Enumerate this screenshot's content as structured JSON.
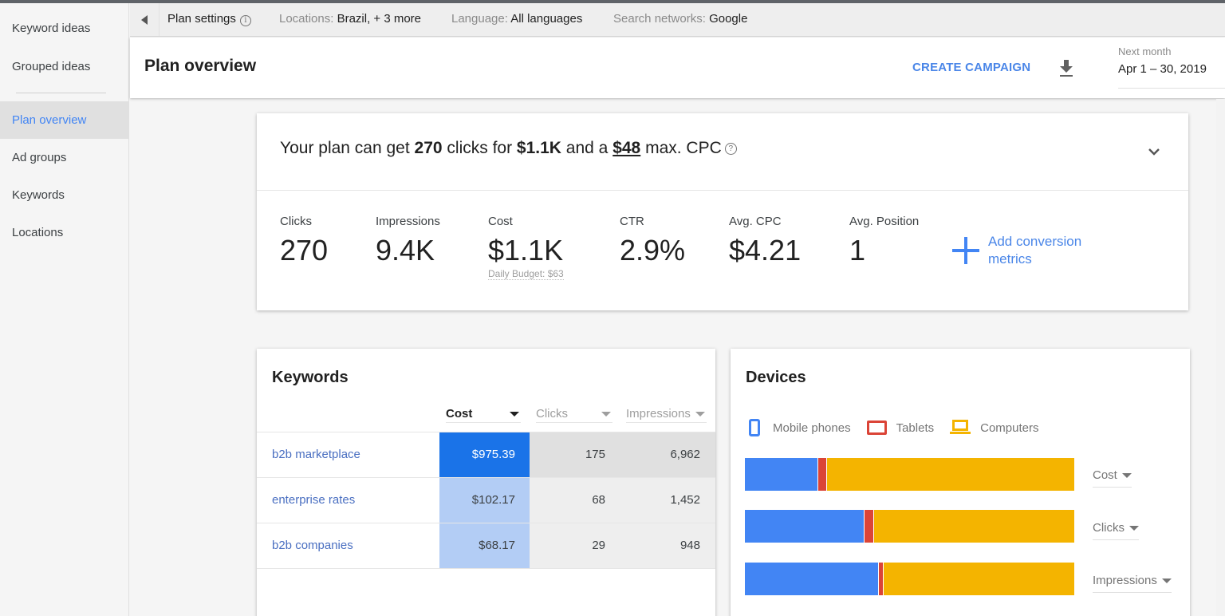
{
  "sidebar": {
    "items": [
      {
        "label": "Keyword ideas"
      },
      {
        "label": "Grouped ideas"
      },
      {
        "label": "Plan overview",
        "active": true
      },
      {
        "label": "Ad groups"
      },
      {
        "label": "Keywords"
      },
      {
        "label": "Locations"
      }
    ]
  },
  "settings_bar": {
    "collapse_icon": "chevron-left",
    "plan_settings": "Plan settings",
    "info_icon": "i",
    "locations": {
      "label": "Locations:",
      "value": "Brazil, + 3 more"
    },
    "language": {
      "label": "Language:",
      "value": "All languages"
    },
    "networks": {
      "label": "Search networks:",
      "value": "Google"
    }
  },
  "header": {
    "title": "Plan overview",
    "create_campaign": "CREATE CAMPAIGN",
    "download_icon": "download",
    "date_range": {
      "caption": "Next month",
      "value": "Apr 1 – 30, 2019"
    }
  },
  "summary": {
    "sentence": {
      "p1": "Your plan can get ",
      "clicks": "270",
      "p2": " clicks for ",
      "cost": "$1.1K",
      "p3": " and a ",
      "max_cpc": "$48",
      "p4": " max. CPC",
      "help_icon": "?"
    },
    "metrics": [
      {
        "label": "Clicks",
        "value": "270"
      },
      {
        "label": "Impressions",
        "value": "9.4K"
      },
      {
        "label": "Cost",
        "value": "$1.1K",
        "sub": "Daily Budget: $63"
      },
      {
        "label": "CTR",
        "value": "2.9%"
      },
      {
        "label": "Avg. CPC",
        "value": "$4.21"
      },
      {
        "label": "Avg. Position",
        "value": "1"
      }
    ],
    "add_conversion": "Add conversion metrics"
  },
  "keywords": {
    "title": "Keywords",
    "columns": [
      {
        "label": "Cost",
        "active": true
      },
      {
        "label": "Clicks"
      },
      {
        "label": "Impressions"
      }
    ],
    "rows": [
      {
        "keyword": "b2b marketplace",
        "cost": "$975.39",
        "clicks": "175",
        "impressions": "6,962"
      },
      {
        "keyword": "enterprise rates",
        "cost": "$102.17",
        "clicks": "68",
        "impressions": "1,452"
      },
      {
        "keyword": "b2b companies",
        "cost": "$68.17",
        "clicks": "29",
        "impressions": "948"
      }
    ],
    "colors": {
      "cost_top": "#1a73e8",
      "cost_other": "#b3cdf5",
      "row_top_other": "#e0e0e0",
      "row_other": "#eeeeee"
    }
  },
  "devices": {
    "title": "Devices",
    "legend": [
      {
        "name": "Mobile phones",
        "color": "#4285f4"
      },
      {
        "name": "Tablets",
        "color": "#db4437"
      },
      {
        "name": "Computers",
        "color": "#f4b400"
      }
    ],
    "bars": [
      {
        "metric": "Cost",
        "shares_pct": [
          22,
          2.7,
          75.3
        ]
      },
      {
        "metric": "Clicks",
        "shares_pct": [
          36,
          3.1,
          60.9
        ]
      },
      {
        "metric": "Impressions",
        "shares_pct": [
          40.4,
          1.5,
          58.1
        ]
      }
    ]
  }
}
